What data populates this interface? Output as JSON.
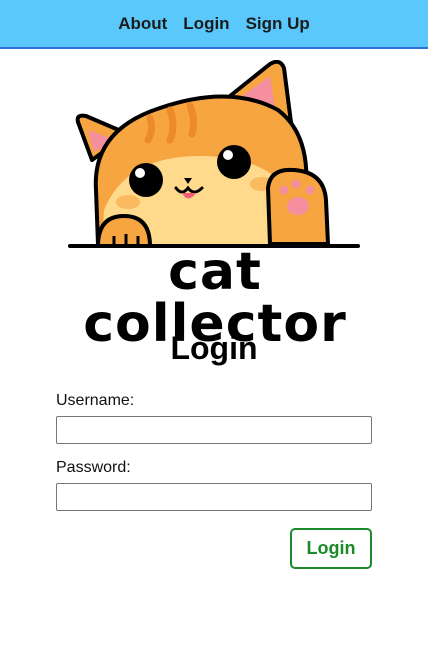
{
  "nav": {
    "about": "About",
    "login": "Login",
    "signup": "Sign Up"
  },
  "logo": {
    "text": "cat collector"
  },
  "form": {
    "title": "Login",
    "username_label": "Username:",
    "username_value": "",
    "password_label": "Password:",
    "password_value": "",
    "submit_label": "Login"
  },
  "colors": {
    "navbar": "#5ac8fa",
    "navbar_border": "#2f6fd8",
    "button_accent": "#1a8a2a",
    "cat_orange": "#f7a541",
    "cat_cream": "#ffd98c"
  }
}
